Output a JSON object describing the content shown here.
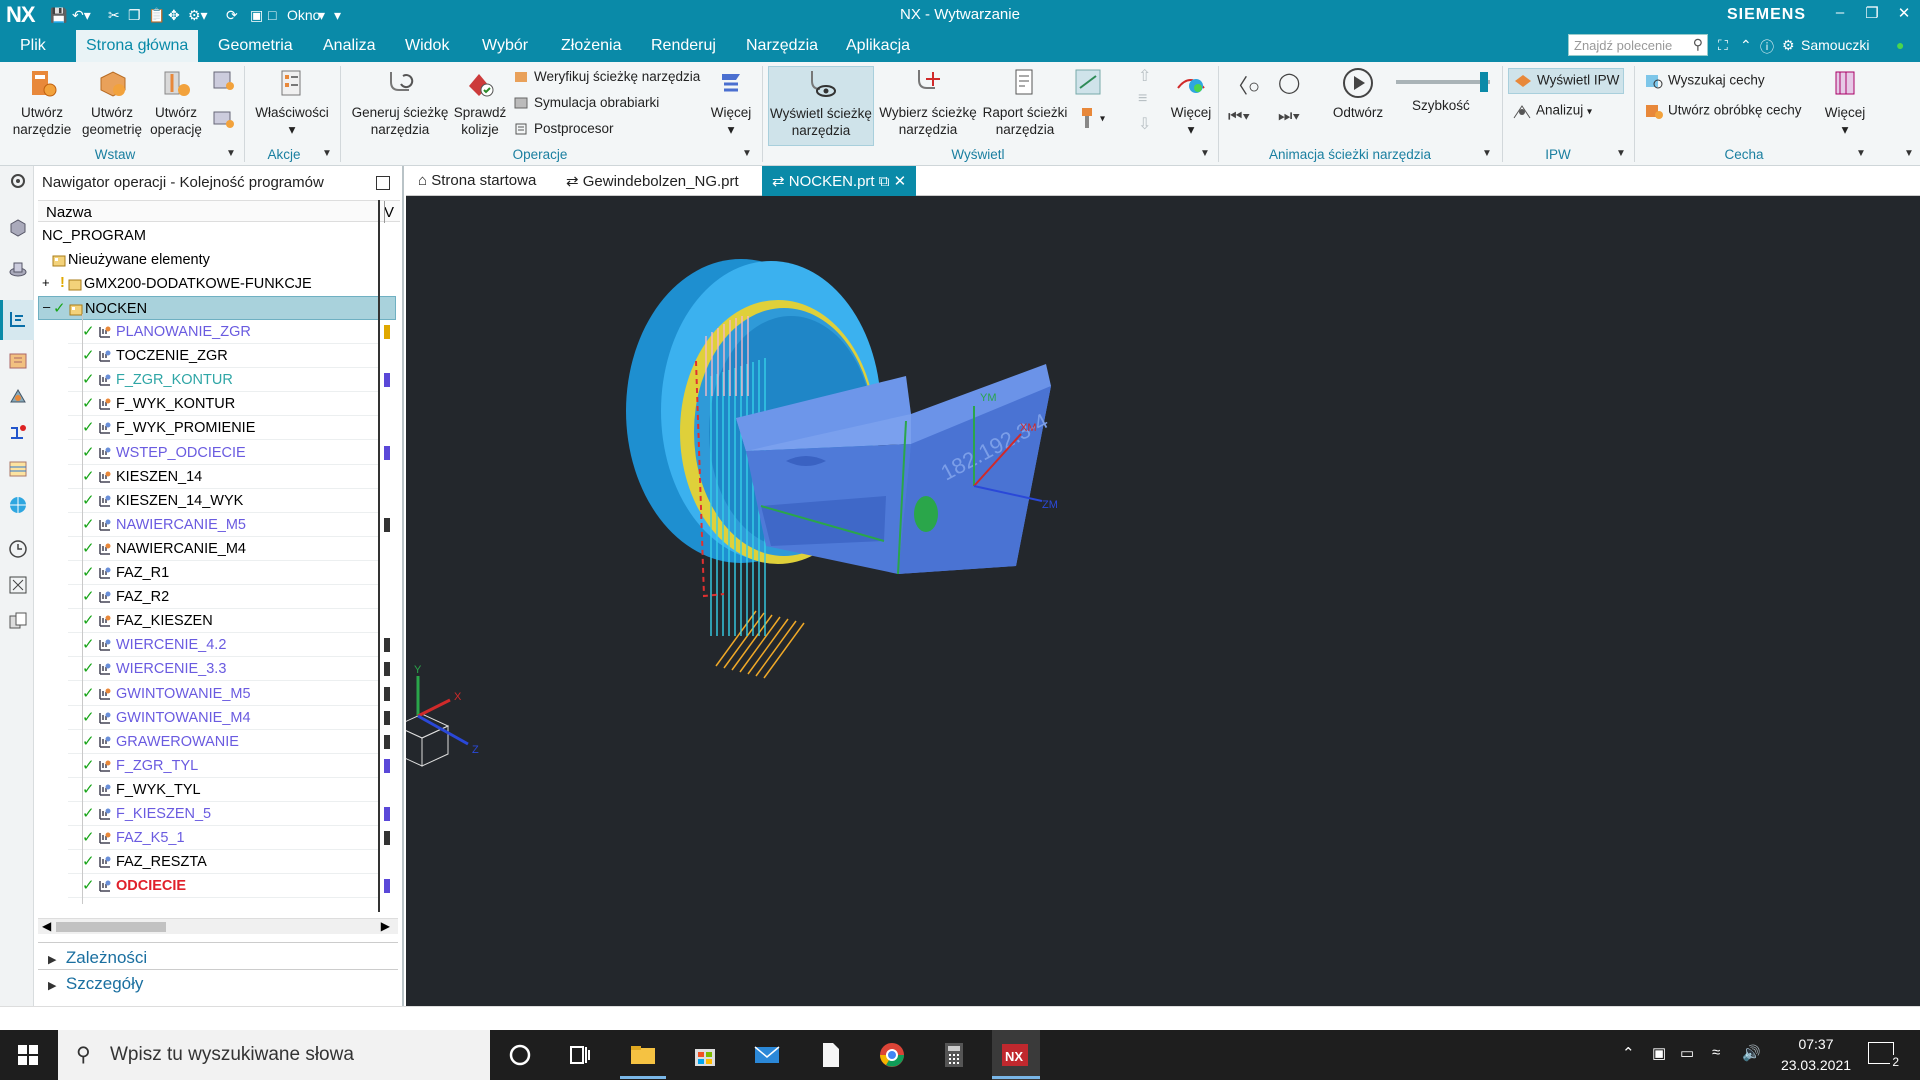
{
  "titlebar": {
    "logo": "NX",
    "window_label": "Okno",
    "title": "NX - Wytwarzanie",
    "brand": "SIEMENS"
  },
  "menubar": {
    "items": [
      "Plik",
      "Strona główna",
      "Geometria",
      "Analiza",
      "Widok",
      "Wybór",
      "Złożenia",
      "Renderuj",
      "Narzędzia",
      "Aplikacja"
    ],
    "active_index": 1,
    "search_placeholder": "Znajdź polecenie",
    "learn_label": "Samouczki"
  },
  "ribbon": {
    "groups": {
      "wstaw": "Wstaw",
      "akcje": "Akcje",
      "operacje": "Operacje",
      "wyswietl": "Wyświetl",
      "animacja": "Animacja ścieżki narzędzia",
      "ipw": "IPW",
      "cecha": "Cecha"
    },
    "buttons": {
      "create_tool": [
        "Utwórz",
        "narzędzie"
      ],
      "create_geometry": [
        "Utwórz",
        "geometrię"
      ],
      "create_operation": [
        "Utwórz",
        "operację"
      ],
      "properties": "Właściwości",
      "generate_path": [
        "Generuj ścieżkę",
        "narzędzia"
      ],
      "check_collisions": [
        "Sprawdź",
        "kolizje"
      ],
      "verify_path": "Weryfikuj ścieżkę narzędzia",
      "machine_sim": "Symulacja obrabiarki",
      "postprocessor": "Postprocesor",
      "more1": "Więcej",
      "show_path": [
        "Wyświetl ścieżkę",
        "narzędzia"
      ],
      "select_path": [
        "Wybierz ścieżkę",
        "narzędzia"
      ],
      "path_report": [
        "Raport ścieżki",
        "narzędzia"
      ],
      "more2": "Więcej",
      "play": "Odtwórz",
      "speed": "Szybkość",
      "show_ipw": "Wyświetl IPW",
      "analyze": "Analizuj",
      "find_features": "Wyszukaj cechy",
      "create_feature_process": "Utwórz obróbkę cechy",
      "more3": "Więcej"
    }
  },
  "navigator": {
    "title": "Nawigator operacji - Kolejność programów",
    "col_name": "Nazwa",
    "col_v": "V",
    "root": "NC_PROGRAM",
    "unused": "Nieużywane elementy",
    "group": "GMX200-DODATKOWE-FUNKCJE",
    "program": "NOCKEN",
    "operations": [
      {
        "label": "PLANOWANIE_ZGR",
        "style": "blue"
      },
      {
        "label": "TOCZENIE_ZGR",
        "style": "normal"
      },
      {
        "label": "F_ZGR_KONTUR",
        "style": "green"
      },
      {
        "label": "F_WYK_KONTUR",
        "style": "normal"
      },
      {
        "label": "F_WYK_PROMIENIE",
        "style": "normal"
      },
      {
        "label": "WSTEP_ODCIECIE",
        "style": "blue"
      },
      {
        "label": "KIESZEN_14",
        "style": "normal"
      },
      {
        "label": "KIESZEN_14_WYK",
        "style": "normal"
      },
      {
        "label": "NAWIERCANIE_M5",
        "style": "blue"
      },
      {
        "label": "NAWIERCANIE_M4",
        "style": "normal"
      },
      {
        "label": "FAZ_R1",
        "style": "normal"
      },
      {
        "label": "FAZ_R2",
        "style": "normal"
      },
      {
        "label": "FAZ_KIESZEN",
        "style": "normal"
      },
      {
        "label": "WIERCENIE_4.2",
        "style": "blue"
      },
      {
        "label": "WIERCENIE_3.3",
        "style": "blue"
      },
      {
        "label": "GWINTOWANIE_M5",
        "style": "blue"
      },
      {
        "label": "GWINTOWANIE_M4",
        "style": "blue"
      },
      {
        "label": "GRAWEROWANIE",
        "style": "blue"
      },
      {
        "label": "F_ZGR_TYL",
        "style": "blue"
      },
      {
        "label": "F_WYK_TYL",
        "style": "normal"
      },
      {
        "label": "F_KIESZEN_5",
        "style": "blue"
      },
      {
        "label": "FAZ_K5_1",
        "style": "blue"
      },
      {
        "label": "FAZ_RESZTA",
        "style": "normal"
      },
      {
        "label": "ODCIECIE",
        "style": "red"
      }
    ],
    "dependencies": "Zależności",
    "details": "Szczegóły"
  },
  "tabs": [
    {
      "label": "Strona startowa"
    },
    {
      "label": "Gewindebolzen_NG.prt"
    },
    {
      "label": "NOCKEN.prt",
      "active": true
    }
  ],
  "viewport": {
    "engraving": "182.192.3-4",
    "axis_x": "X",
    "axis_y": "Y",
    "axis_z": "Z",
    "wcs_ym": "YM",
    "wcs_xm": "XM",
    "wcs_zm": "ZM"
  },
  "taskbar": {
    "search_placeholder": "Wpisz tu wyszukiwane słowa",
    "time": "07:37",
    "date": "23.03.2021",
    "notifications": "2"
  },
  "colors": {
    "accent": "#0a8aa8",
    "viewport_bg": "#23272c",
    "part_blue": "#4f7fe0",
    "fixture_cyan": "#2ea6e0",
    "fixture_yellow": "#e6d23a"
  }
}
